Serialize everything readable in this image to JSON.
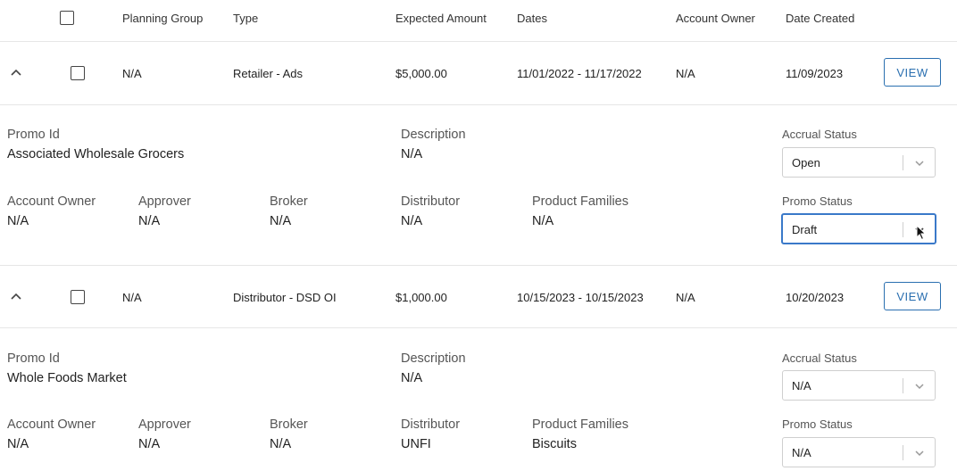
{
  "header": {
    "planning_group": "Planning Group",
    "type": "Type",
    "expected_amount": "Expected Amount",
    "dates": "Dates",
    "account_owner": "Account Owner",
    "date_created": "Date Created"
  },
  "rows": [
    {
      "planning_group": "N/A",
      "type": "Retailer - Ads",
      "expected_amount": "$5,000.00",
      "dates": "11/01/2022 - 11/17/2022",
      "account_owner": "N/A",
      "date_created": "11/09/2023",
      "view_label": "VIEW",
      "detail": {
        "promo_id_label": "Promo Id",
        "promo_id_value": "Associated Wholesale Grocers",
        "description_label": "Description",
        "description_value": "N/A",
        "account_owner_label": "Account Owner",
        "account_owner_value": "N/A",
        "approver_label": "Approver",
        "approver_value": "N/A",
        "broker_label": "Broker",
        "broker_value": "N/A",
        "distributor_label": "Distributor",
        "distributor_value": "N/A",
        "product_families_label": "Product Families",
        "product_families_value": "N/A",
        "accrual_status_label": "Accrual Status",
        "accrual_status_value": "Open",
        "promo_status_label": "Promo Status",
        "promo_status_value": "Draft"
      }
    },
    {
      "planning_group": "N/A",
      "type": "Distributor - DSD OI",
      "expected_amount": "$1,000.00",
      "dates": "10/15/2023 - 10/15/2023",
      "account_owner": "N/A",
      "date_created": "10/20/2023",
      "view_label": "VIEW",
      "detail": {
        "promo_id_label": "Promo Id",
        "promo_id_value": "Whole Foods Market",
        "description_label": "Description",
        "description_value": "N/A",
        "account_owner_label": "Account Owner",
        "account_owner_value": "N/A",
        "approver_label": "Approver",
        "approver_value": "N/A",
        "broker_label": "Broker",
        "broker_value": "N/A",
        "distributor_label": "Distributor",
        "distributor_value": "UNFI",
        "product_families_label": "Product Families",
        "product_families_value": "Biscuits",
        "accrual_status_label": "Accrual Status",
        "accrual_status_value": "N/A",
        "promo_status_label": "Promo Status",
        "promo_status_value": "N/A"
      }
    }
  ],
  "colors": {
    "accent": "#2a6fb0",
    "focus_border": "#3a79c9",
    "divider": "#e6e6e6"
  }
}
